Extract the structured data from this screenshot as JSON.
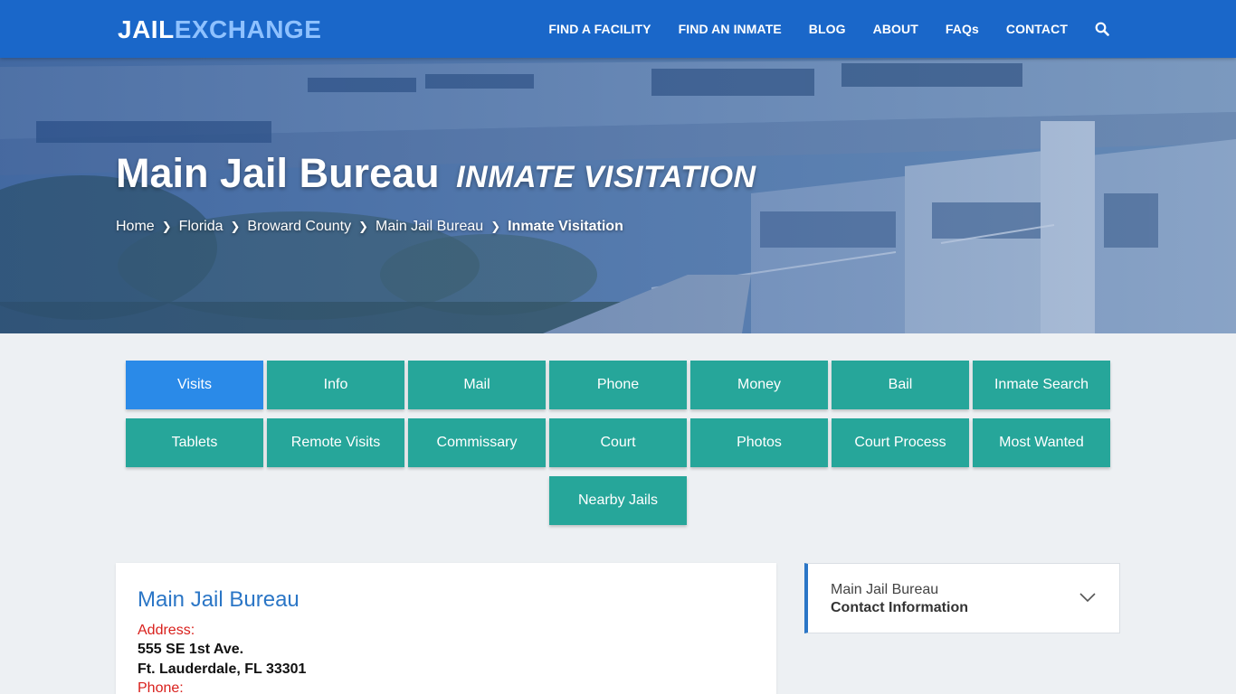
{
  "header": {
    "logo_part1": "JAIL",
    "logo_part2": "EXCHANGE",
    "nav": [
      "FIND A FACILITY",
      "FIND AN INMATE",
      "BLOG",
      "ABOUT",
      "FAQs",
      "CONTACT"
    ],
    "search_icon": "search-icon"
  },
  "hero": {
    "title": "Main Jail Bureau",
    "subtitle": "Inmate Visitation",
    "breadcrumb": [
      "Home",
      "Florida",
      "Broward County",
      "Main Jail Bureau",
      "Inmate Visitation"
    ]
  },
  "tabs": {
    "row1": [
      "Visits",
      "Info",
      "Mail",
      "Phone",
      "Money",
      "Bail",
      "Inmate Search"
    ],
    "row2": [
      "Tablets",
      "Remote Visits",
      "Commissary",
      "Court",
      "Photos",
      "Court Process",
      "Most Wanted"
    ],
    "row3": [
      "Nearby Jails"
    ],
    "active": "Visits"
  },
  "card": {
    "title": "Main Jail Bureau",
    "address_label": "Address:",
    "address_line1": "555 SE 1st Ave.",
    "address_line2": "Ft. Lauderdale, FL 33301",
    "phone_label": "Phone:"
  },
  "sidebar": {
    "line1": "Main Jail Bureau",
    "line2": "Contact Information",
    "icon": "chevron-down-icon"
  },
  "colors": {
    "header_bg": "#1a67c9",
    "tab_bg": "#26a69a",
    "tab_active": "#2a8ae8",
    "link_blue": "#2b76c6",
    "label_red": "#d9201c"
  }
}
